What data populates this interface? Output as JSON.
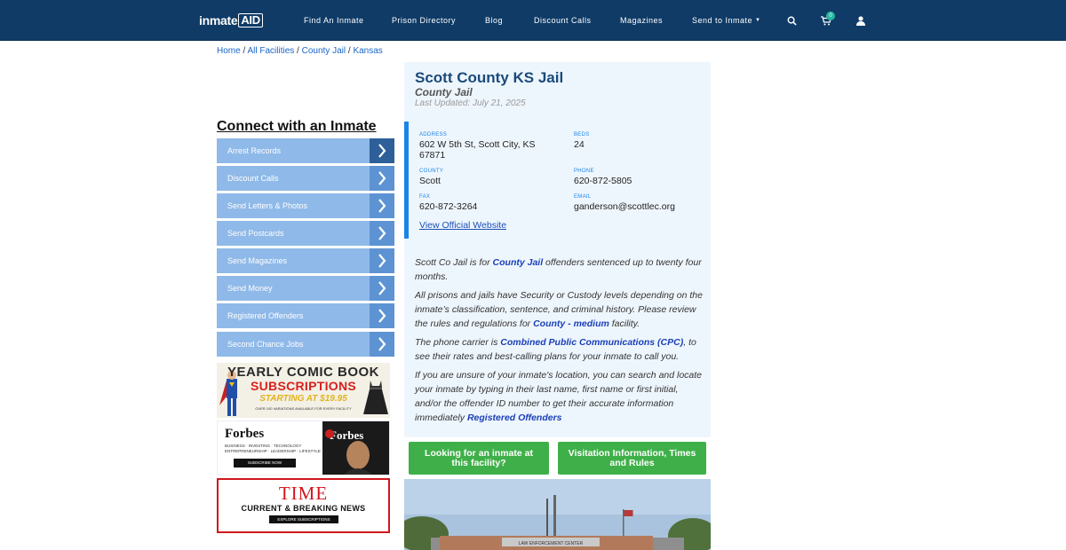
{
  "header": {
    "logo_text": "inmate",
    "logo_aid": "AID",
    "nav": [
      "Find An Inmate",
      "Prison Directory",
      "Blog",
      "Discount Calls",
      "Magazines",
      "Send to Inmate"
    ],
    "cart_count": "0",
    "icons": [
      "search-icon",
      "cart-icon",
      "user-icon"
    ]
  },
  "breadcrumb": {
    "home": "Home",
    "all": "All Facilities",
    "type": "County Jail",
    "state": "Kansas",
    "sep": " / "
  },
  "left": {
    "title": "Connect with an Inmate",
    "services": [
      "Arrest Records",
      "Discount Calls",
      "Send Letters & Photos",
      "Send Postcards",
      "Send Magazines",
      "Send Money",
      "Registered Offenders",
      "Second Chance Jobs"
    ]
  },
  "ads": {
    "comic_line1": "YEARLY COMIC BOOK",
    "comic_line2": "SUBSCRIPTIONS",
    "comic_line3": "STARTING AT $19.95",
    "comic_line4": "OVER 100 VARIATIONS AVAILABLE FOR EVERY FACILITY",
    "forbes_title": "Forbes",
    "forbes_tag1": "BUSINESS · INVESTING · TECHNOLOGY",
    "forbes_tag2": "ENTREPRENEURSHIP · LEADERSHIP · LIFESTYLE",
    "forbes_btn": "SUBSCRIBE NOW",
    "forbes_cover": "Forbes",
    "time_title": "TIME",
    "time_sub": "CURRENT & BREAKING NEWS",
    "time_btn": "EXPLORE SUBSCRIPTIONS"
  },
  "facility": {
    "name": "Scott County KS Jail",
    "type": "County Jail",
    "updated": "Last Updated: July 21, 2025",
    "address_label": "ADDRESS",
    "address": "602 W 5th St, Scott City, KS 67871",
    "beds_label": "BEDS",
    "beds": "24",
    "county_label": "COUNTY",
    "county": "Scott",
    "phone_label": "PHONE",
    "phone": "620-872-5805",
    "fax_label": "FAX",
    "fax": "620-872-3264",
    "email_label": "EMAIL",
    "email": "ganderson@scottlec.org",
    "website": "View Official Website"
  },
  "desc": {
    "p1a": "Scott Co Jail is for ",
    "p1b": "County Jail",
    "p1c": " offenders sentenced up to twenty four months.",
    "p2a": "All prisons and jails have Security or Custody levels depending on the inmate’s classification, sentence, and criminal history. Please review the rules and regulations for ",
    "p2b": "County - medium",
    "p2c": " facility.",
    "p3a": "The phone carrier is ",
    "p3b": "Combined Public Communications (CPC)",
    "p3c": ", to see their rates and best-calling plans for your inmate to call you.",
    "p4a": "If you are unsure of your inmate's location, you can search and locate your inmate by typing in their last name, first name or first initial, and/or the offender ID number to get their accurate information immediately ",
    "p4b": "Registered Offenders"
  },
  "buttons": {
    "look": "Looking for an inmate at this facility?",
    "visit": "Visitation Information, Times and Rules"
  },
  "photo": {
    "sign": "LAW ENFORCEMENT CENTER"
  },
  "colors": {
    "nav_bg": "#0f3b66",
    "accent": "#1b84e8",
    "service_bg": "#8fb9e8",
    "button_green": "#3fb049",
    "panel_bg": "#eef6fd"
  }
}
